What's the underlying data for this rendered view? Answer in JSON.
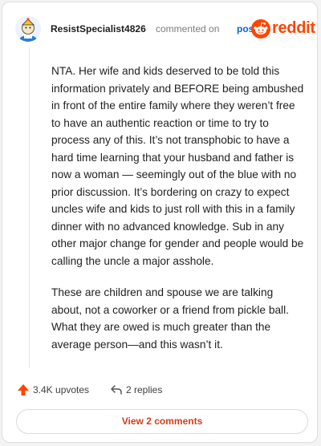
{
  "comment": {
    "username": "ResistSpecialist4826",
    "action_text": "commented on",
    "post_link": "post",
    "brand": "reddit",
    "paragraphs": [
      "NTA. Her wife and kids deserved to be told this information privately and BEFORE being ambushed in front of the entire family where they weren’t free to have an authentic reaction or time to try to process any of this. It’s not transphobic to have a hard time learning that your husband and father is now a woman — seemingly out of the blue with no prior discussion. It’s bordering on crazy to expect uncles wife and kids to just roll with this in a family dinner with no advanced knowledge. Sub in any other major change for gender and people would be calling the uncle a major asshole.",
      "These are children and spouse we are talking about, not a coworker or a friend from pickle ball. What they are owed is much greater than the average person—and this wasn’t it."
    ],
    "upvotes": "3.4K upvotes",
    "replies": "2 replies",
    "view_button": "View 2 comments"
  },
  "icons": {
    "avatar": "avatar-icon",
    "reddit_logo": "reddit-logo-icon",
    "upvote": "upvote-arrow-icon",
    "reply": "reply-icon"
  },
  "colors": {
    "accent": "#ff4500",
    "link": "#0a66c2",
    "button_text": "#d73c1b"
  }
}
